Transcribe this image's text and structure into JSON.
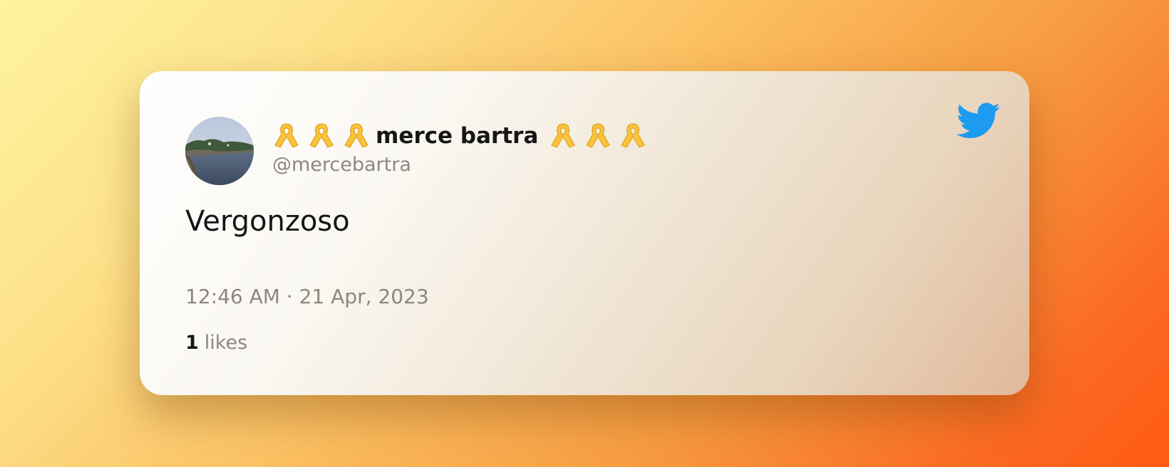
{
  "tweet": {
    "author": {
      "name": "merce bartra",
      "handle": "@mercebartra",
      "ribbons_before": 3,
      "ribbons_after": 3,
      "ribbon_icon": "yellow-ribbon-emoji"
    },
    "text": "Vergonzoso",
    "timestamp": "12:46 AM · 21 Apr, 2023",
    "likes": {
      "count": "1",
      "label": "likes"
    },
    "platform_icon": "twitter-bird-icon"
  },
  "colors": {
    "twitter_blue": "#1d9bf0",
    "name_text": "#161616",
    "secondary_text": "#8b877f",
    "ribbon_yellow": "#f9c33b"
  }
}
